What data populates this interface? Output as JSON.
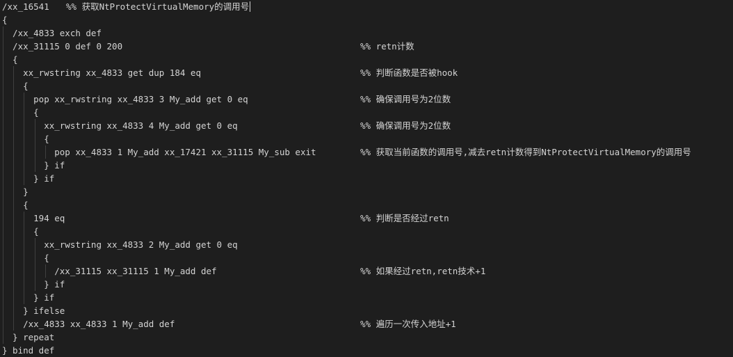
{
  "editor": {
    "lines": [
      {
        "code": "/xx_16541   ",
        "comment": "%% 获取NtProtectVirtualMemory的调用号"
      },
      {
        "code": "{",
        "comment": ""
      },
      {
        "code": "  /xx_4833 exch def",
        "comment": ""
      },
      {
        "code": "  /xx_31115 0 def 0 200",
        "comment": "%% retn计数"
      },
      {
        "code": "  {",
        "comment": ""
      },
      {
        "code": "    xx_rwstring xx_4833 get dup 184 eq",
        "comment": "%% 判断函数是否被hook"
      },
      {
        "code": "    {",
        "comment": ""
      },
      {
        "code": "      pop xx_rwstring xx_4833 3 My_add get 0 eq",
        "comment": "%% 确保调用号为2位数"
      },
      {
        "code": "      {",
        "comment": ""
      },
      {
        "code": "        xx_rwstring xx_4833 4 My_add get 0 eq",
        "comment": "%% 确保调用号为2位数"
      },
      {
        "code": "        {",
        "comment": ""
      },
      {
        "code": "          pop xx_4833 1 My_add xx_17421 xx_31115 My_sub exit",
        "comment": "%% 获取当前函数的调用号,减去retn计数得到NtProtectVirtualMemory的调用号"
      },
      {
        "code": "        } if",
        "comment": ""
      },
      {
        "code": "      } if",
        "comment": ""
      },
      {
        "code": "    }",
        "comment": ""
      },
      {
        "code": "    {",
        "comment": ""
      },
      {
        "code": "      194 eq",
        "comment": "%% 判断是否经过retn"
      },
      {
        "code": "      {",
        "comment": ""
      },
      {
        "code": "        xx_rwstring xx_4833 2 My_add get 0 eq",
        "comment": ""
      },
      {
        "code": "        {",
        "comment": ""
      },
      {
        "code": "          /xx_31115 xx_31115 1 My_add def",
        "comment": "%% 如果经过retn,retn技术+1"
      },
      {
        "code": "        } if",
        "comment": ""
      },
      {
        "code": "      } if",
        "comment": ""
      },
      {
        "code": "    } ifelse",
        "comment": ""
      },
      {
        "code": "    /xx_4833 xx_4833 1 My_add def",
        "comment": "%% 遍历一次传入地址+1"
      },
      {
        "code": "  } repeat",
        "comment": ""
      },
      {
        "code": "} bind def",
        "comment": ""
      }
    ],
    "colors": {
      "background": "#1e1e1e",
      "text": "#d4d4d4",
      "indent_guide": "#404040"
    }
  }
}
